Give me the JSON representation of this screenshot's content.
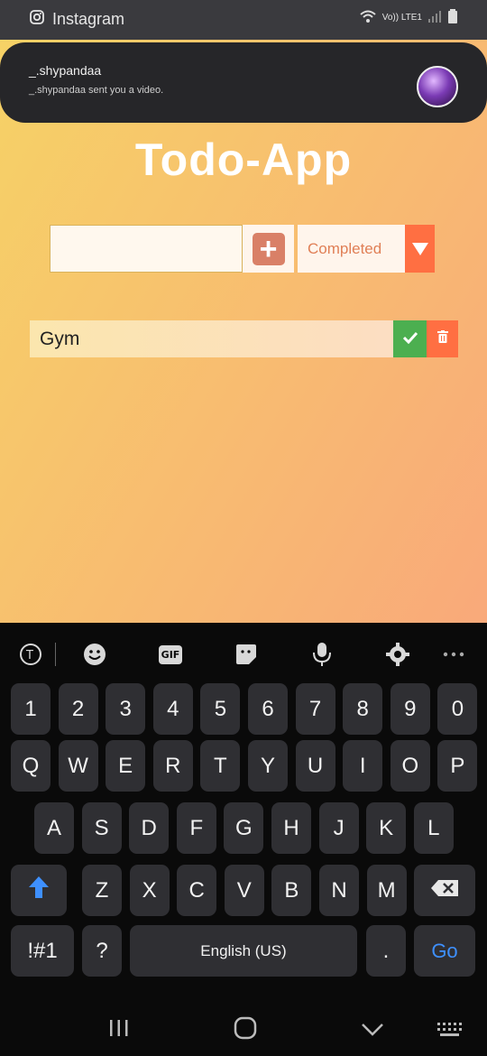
{
  "status_bar": {
    "app_name": "Instagram",
    "network": "Vo)) LTE1"
  },
  "notification": {
    "title": "_.shypandaa",
    "body": "_.shypandaa sent you a video."
  },
  "app": {
    "title": "Todo-App",
    "input_value": "",
    "add_button": "+",
    "filter_selected": "Completed",
    "todos": [
      {
        "text": "Gym"
      }
    ]
  },
  "keyboard": {
    "row_numbers": [
      "1",
      "2",
      "3",
      "4",
      "5",
      "6",
      "7",
      "8",
      "9",
      "0"
    ],
    "row_1": [
      "Q",
      "W",
      "E",
      "R",
      "T",
      "Y",
      "U",
      "I",
      "O",
      "P"
    ],
    "row_2": [
      "A",
      "S",
      "D",
      "F",
      "G",
      "H",
      "J",
      "K",
      "L"
    ],
    "row_3": [
      "Z",
      "X",
      "C",
      "V",
      "B",
      "N",
      "M"
    ],
    "symbols_key": "!#1",
    "comma_key": "?",
    "space_label": "English (US)",
    "period_key": ".",
    "go_key": "Go",
    "toolbar_gif": "GIF"
  },
  "colors": {
    "accent": "#ff6f42",
    "check": "#4caf50",
    "go": "#3e90ff"
  }
}
